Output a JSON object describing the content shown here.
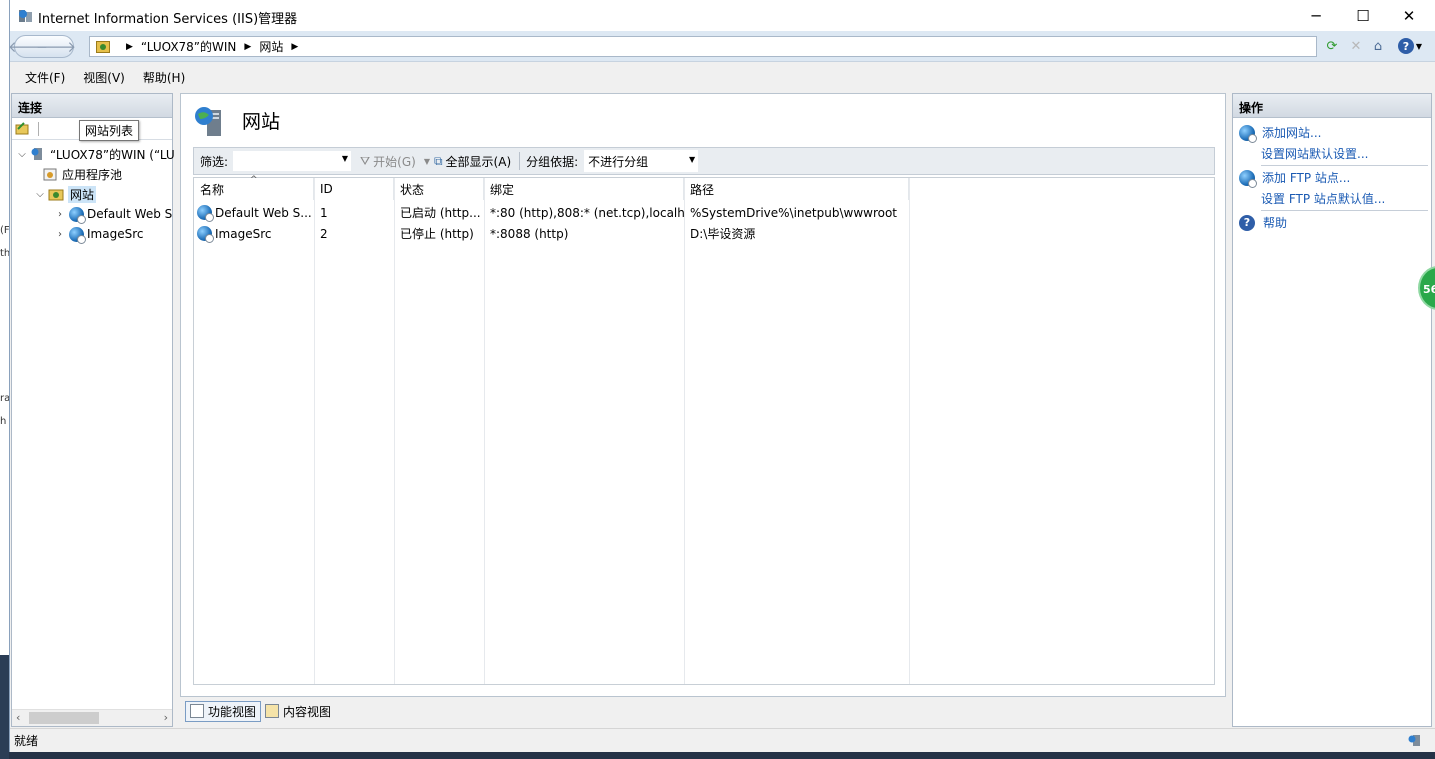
{
  "window": {
    "title": "Internet Information Services (IIS)管理器"
  },
  "address": {
    "crumbs": [
      "“LUOX78”的WIN",
      "网站"
    ]
  },
  "menu": [
    "文件(F)",
    "视图(V)",
    "帮助(H)"
  ],
  "connections": {
    "header": "连接",
    "tree": {
      "server": "“LUOX78”的WIN (“LU",
      "app_pools": "应用程序池",
      "sites": "网站",
      "site1": "Default Web S",
      "site2": "ImageSrc"
    },
    "tooltip": "网站列表"
  },
  "main": {
    "title": "网站",
    "filter": {
      "label": "筛选:",
      "value": "",
      "start_label": "开始(G)",
      "show_all_label": "全部显示(A)",
      "group_label": "分组依据:",
      "group_value": "不进行分组"
    },
    "columns": [
      "名称",
      "ID",
      "状态",
      "绑定",
      "路径"
    ],
    "rows": [
      {
        "name": "Default Web S...",
        "id": "1",
        "status": "已启动 (http...",
        "binding": "*:80 (http),808:* (net.tcp),localh...",
        "path": "%SystemDrive%\\inetpub\\wwwroot"
      },
      {
        "name": "ImageSrc",
        "id": "2",
        "status": "已停止 (http)",
        "binding": "*:8088 (http)",
        "path": "D:\\毕设资源"
      }
    ],
    "view_tabs": [
      "功能视图",
      "内容视图"
    ]
  },
  "actions": {
    "header": "操作",
    "add_site": "添加网站...",
    "site_defaults": "设置网站默认设置...",
    "add_ftp": "添加 FTP 站点...",
    "ftp_defaults": "设置 FTP 站点默认值...",
    "help": "帮助"
  },
  "status": {
    "text": "就绪"
  },
  "badge": {
    "text": "56"
  },
  "colors": {
    "link": "#1a5ab3",
    "panel_header": "#d2d9e2",
    "accent_badge": "#2aa84a"
  }
}
